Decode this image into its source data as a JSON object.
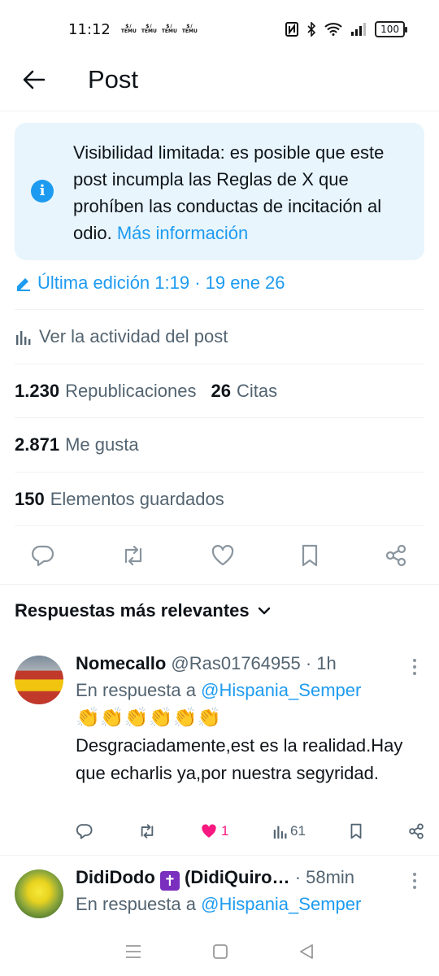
{
  "status_bar": {
    "time": "11:12",
    "temu_icons": [
      "TEMU",
      "TEMU",
      "TEMU",
      "TEMU"
    ],
    "battery": "100"
  },
  "header": {
    "title": "Post"
  },
  "notice": {
    "text": "Visibilidad limitada: es posible que este post incumpla las Reglas de X que prohíben las conductas de incitación al odio.",
    "link": "Más información"
  },
  "edited": {
    "label": "Última edición 1:19 · 19 ene 26"
  },
  "activity": {
    "label": "Ver la actividad del post"
  },
  "stats": {
    "reposts_count": "1.230",
    "reposts_label": "Republicaciones",
    "quotes_count": "26",
    "quotes_label": "Citas",
    "likes_count": "2.871",
    "likes_label": "Me gusta",
    "bookmarks_count": "150",
    "bookmarks_label": "Elementos guardados"
  },
  "replies_sort": {
    "label": "Respuestas más relevantes"
  },
  "replies": [
    {
      "name": "Nomecallo",
      "handle": "@Ras01764955",
      "time": "· 1h",
      "reply_prefix": "En respuesta a",
      "reply_to": "@Hispania_Semper",
      "emojis": "👏👏👏👏👏👏",
      "text": "Desgraciadamente,est es la realidad.Hay que echarlis ya,por nuestra segyridad.",
      "likes": "1",
      "views": "61"
    },
    {
      "name": "DidiDodo",
      "name_suffix": "(DidiQuiro…",
      "time": "· 58min",
      "reply_prefix": "En respuesta a",
      "reply_to": "@Hispania_Semper"
    }
  ],
  "colors": {
    "accent": "#1d9bf0",
    "like": "#f91880",
    "secondary_text": "#536471",
    "notice_bg": "#e8f5fd"
  }
}
